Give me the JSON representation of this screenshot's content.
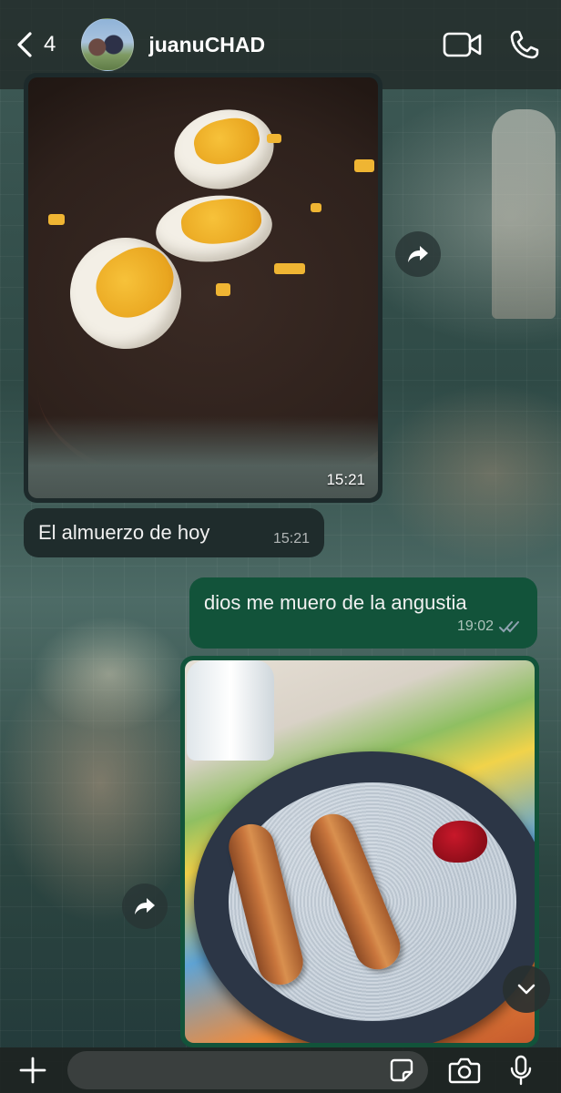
{
  "header": {
    "back_count": "4",
    "contact_name": "juanuCHAD"
  },
  "messages": [
    {
      "type": "image",
      "direction": "incoming",
      "time": "15:21",
      "icon": "forward-icon"
    },
    {
      "type": "text",
      "direction": "incoming",
      "text": "El almuerzo de hoy",
      "time": "15:21"
    },
    {
      "type": "text",
      "direction": "outgoing",
      "text": "dios me muero de la angustia",
      "time": "19:02",
      "status": "read"
    },
    {
      "type": "image",
      "direction": "outgoing",
      "icon": "forward-icon"
    }
  ],
  "input": {
    "placeholder": ""
  },
  "icons": {
    "back": "chevron-left-icon",
    "video": "video-camera-icon",
    "call": "phone-icon",
    "plus": "plus-icon",
    "sticker": "sticker-icon",
    "camera": "camera-icon",
    "mic": "microphone-icon",
    "scroll": "chevron-down-icon",
    "read_color": "#8ea2b0"
  }
}
